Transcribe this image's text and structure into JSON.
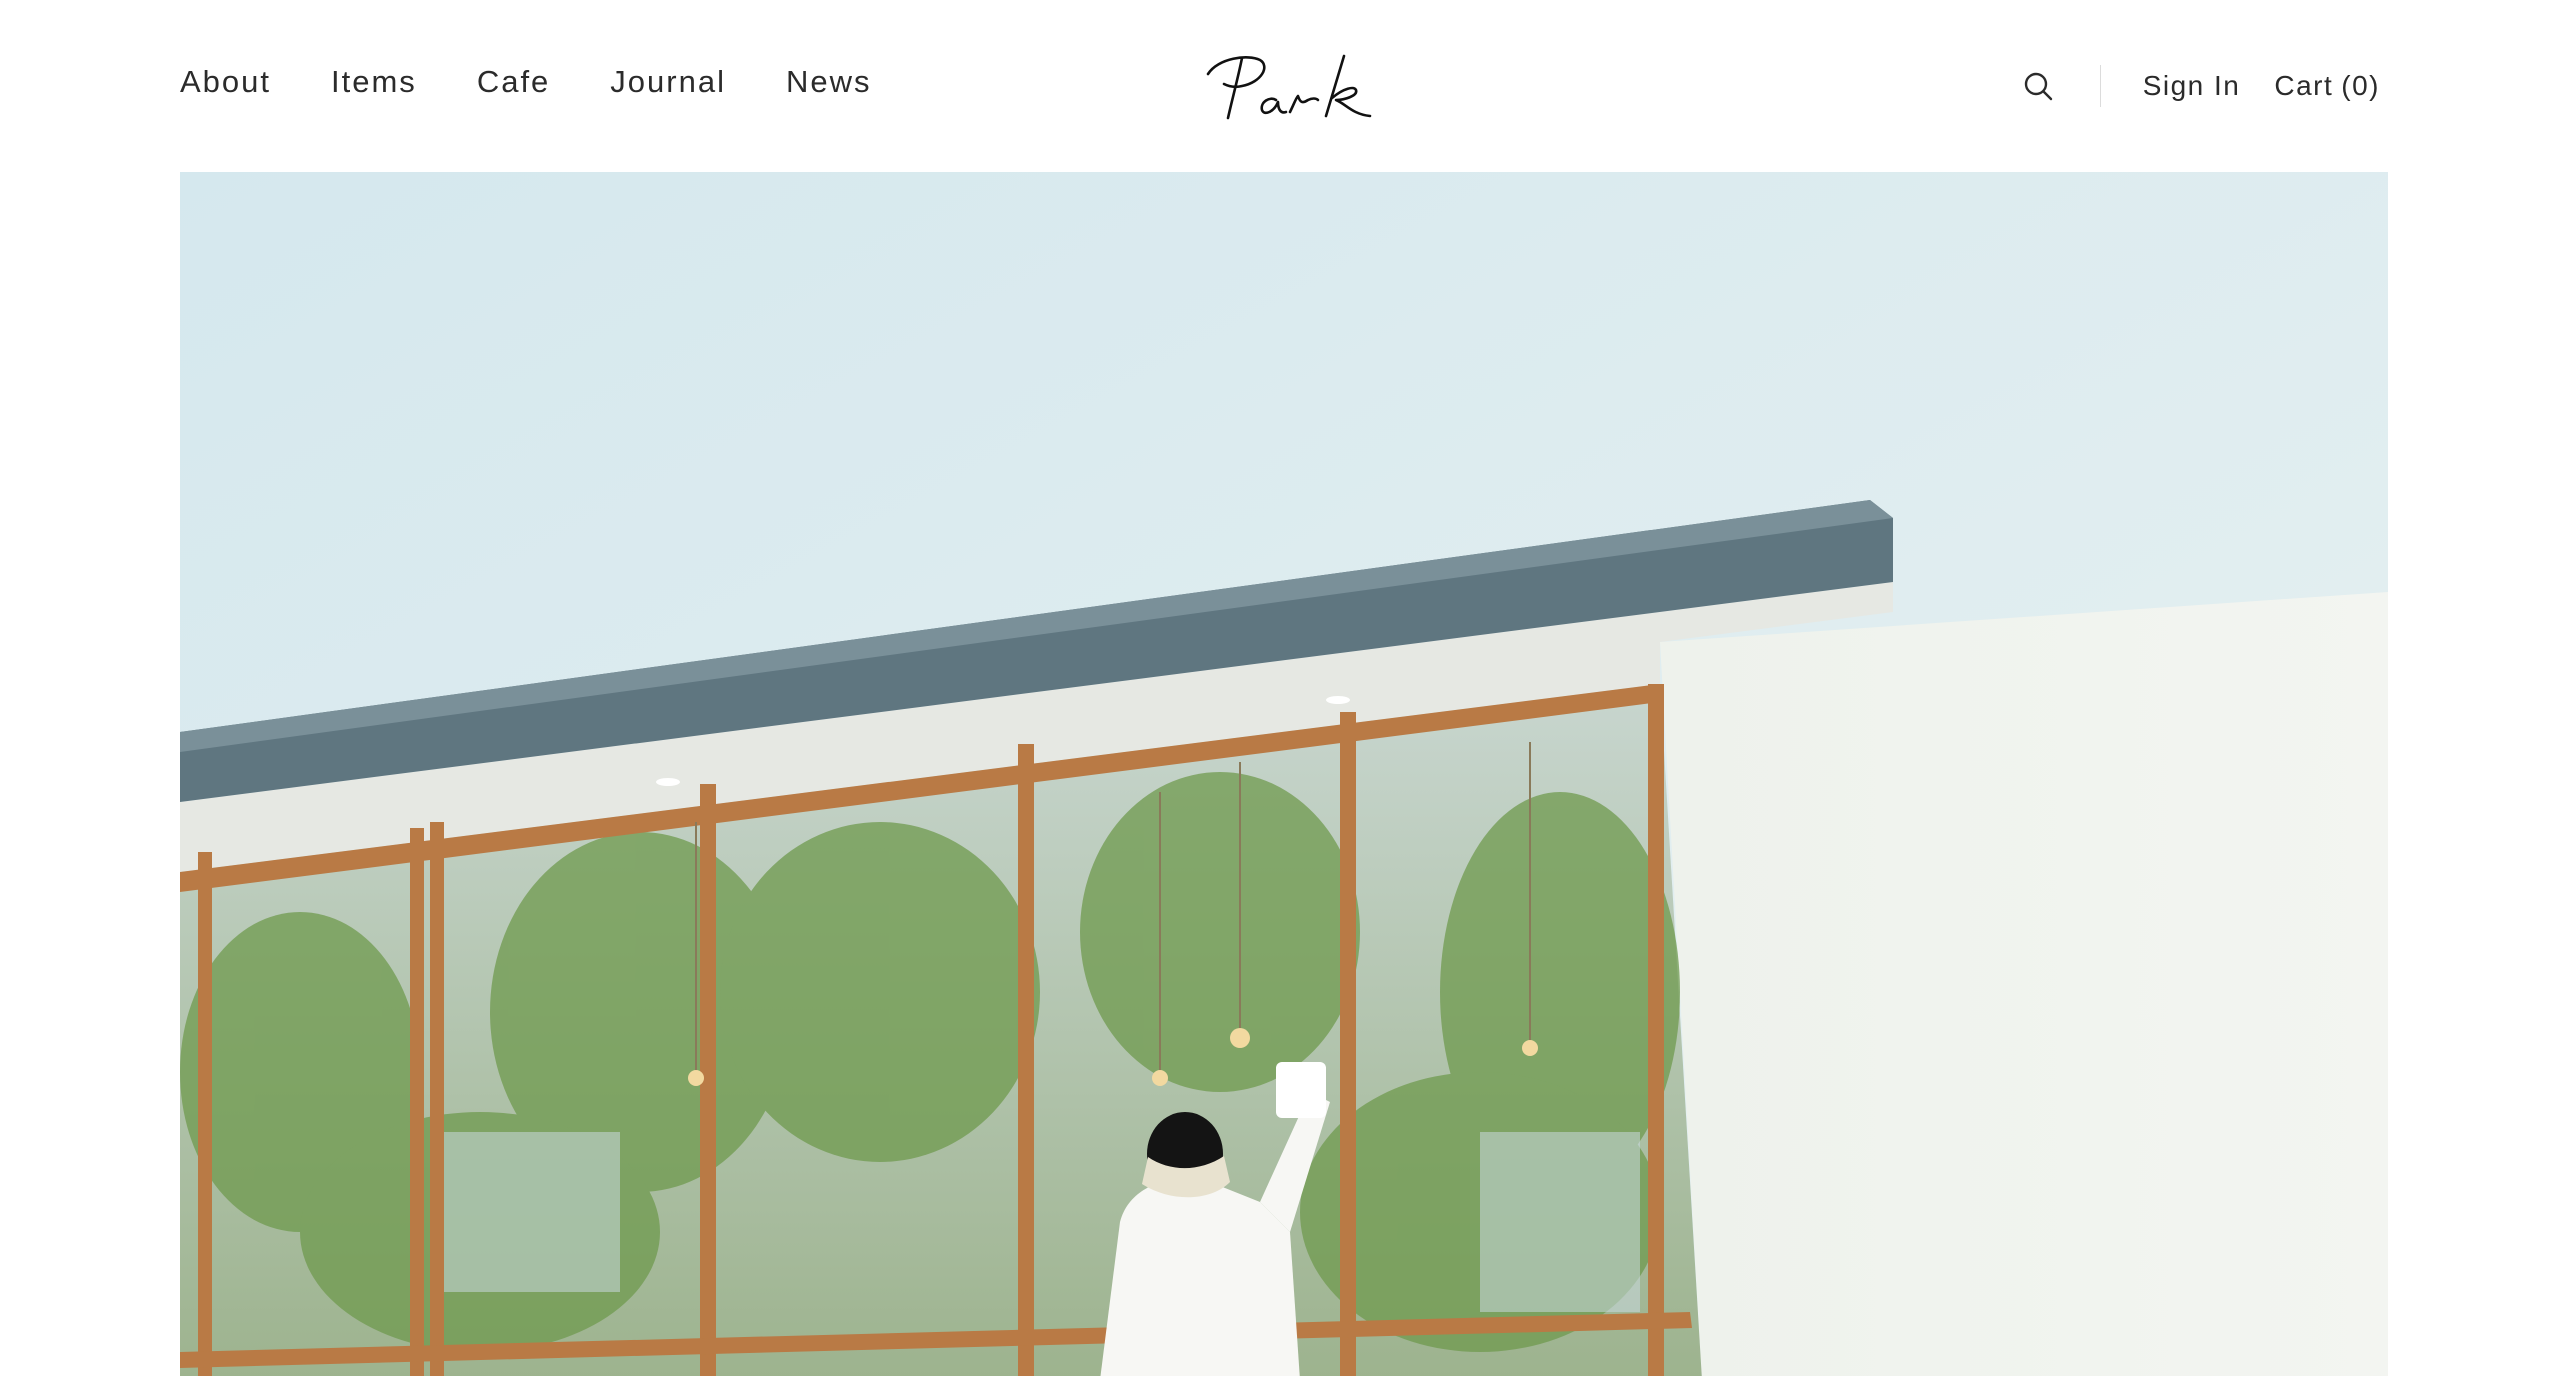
{
  "header": {
    "nav": [
      {
        "label": "About"
      },
      {
        "label": "Items"
      },
      {
        "label": "Cafe"
      },
      {
        "label": "Journal"
      },
      {
        "label": "News"
      }
    ],
    "logo": {
      "text": "Park"
    },
    "search_icon": "search-icon",
    "sign_in_label": "Sign In",
    "cart_label": "Cart",
    "cart_count": "0"
  },
  "hero": {
    "image_description": "white cafe facade with wooden-framed glass windows, a person wiping the window with a cloth"
  },
  "colors": {
    "text": "#2b2b2b",
    "sky": "#dcebef",
    "wall": "#f4f6f2",
    "roof_fascia": "#5f7680",
    "wood_frame": "#b97a45"
  }
}
